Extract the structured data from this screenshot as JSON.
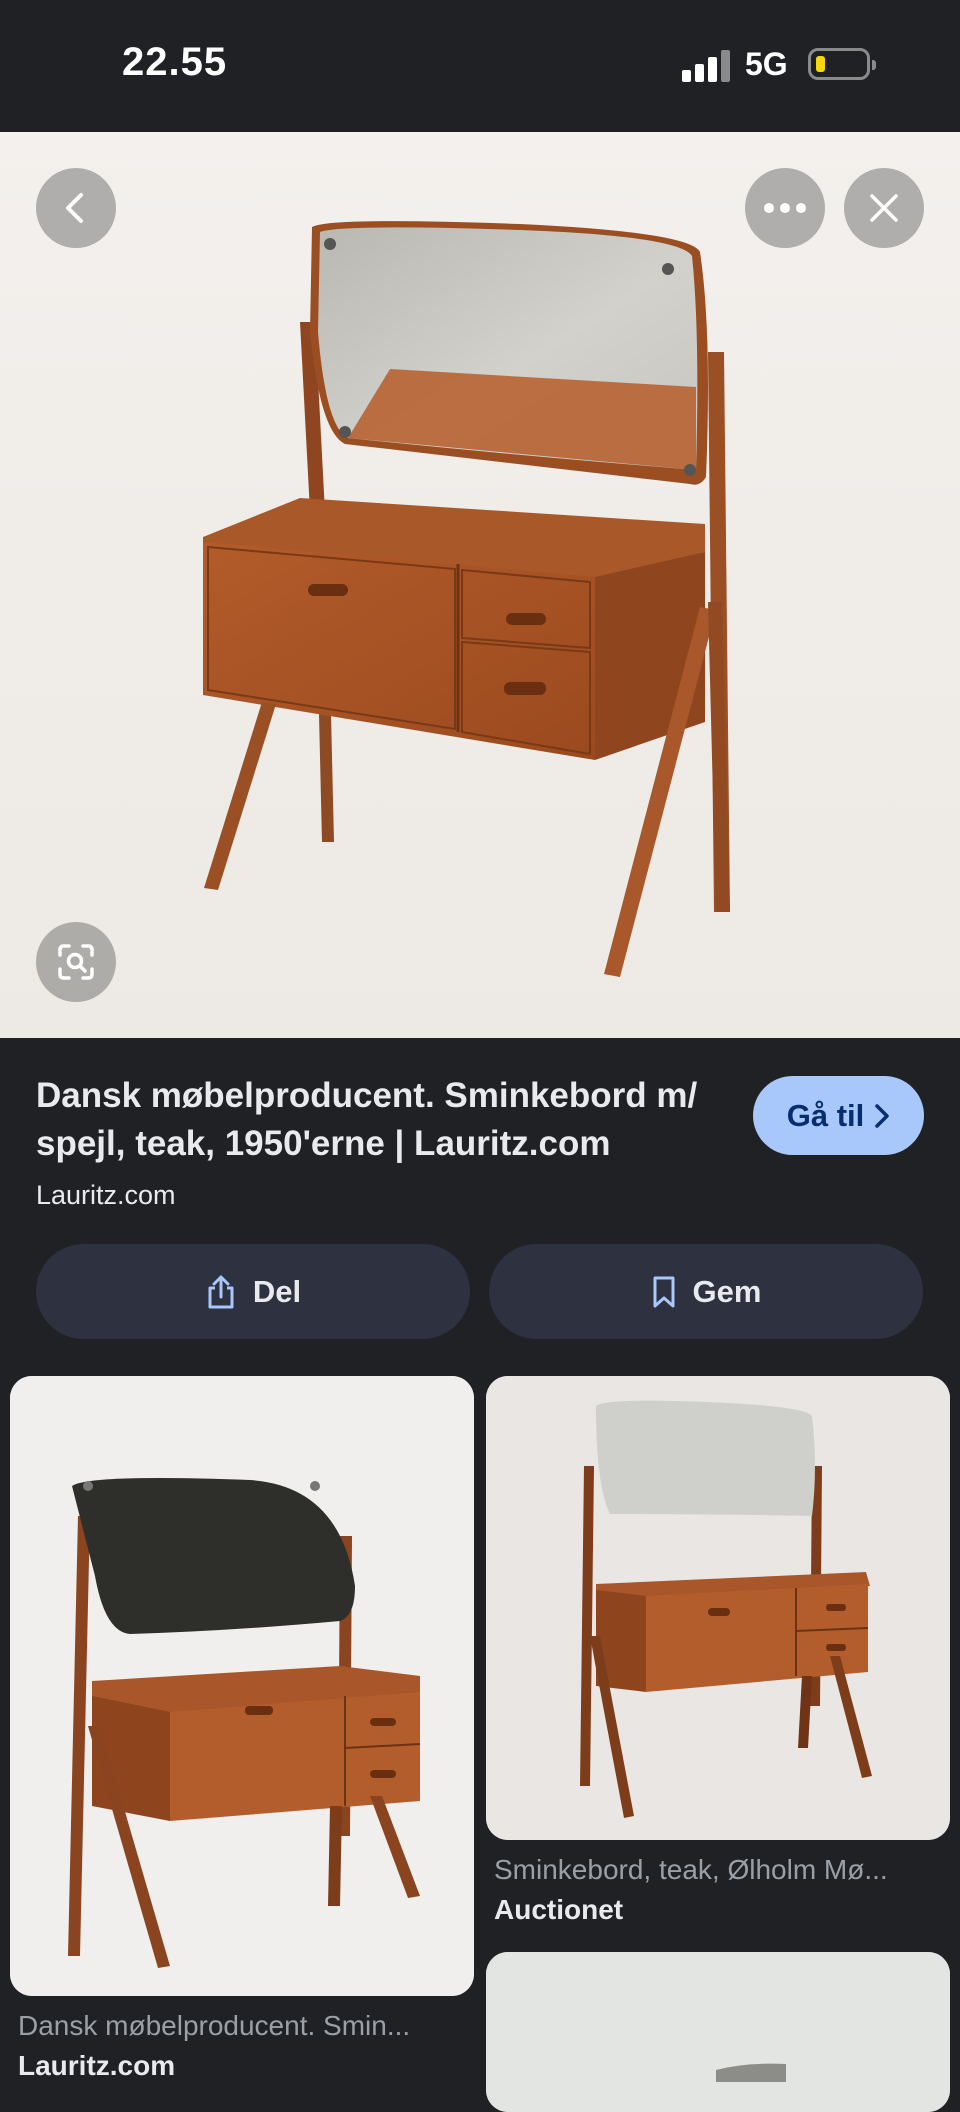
{
  "status_bar": {
    "time": "22.55",
    "network": "5G"
  },
  "hero": {
    "alt": "Teak vanity with mirror"
  },
  "result": {
    "title": "Dansk møbelproducent. Sminkebord m/ spejl, teak, 1950'erne | Lauritz.com",
    "source": "Lauritz.com",
    "goto_label": "Gå til"
  },
  "actions": {
    "share_label": "Del",
    "save_label": "Gem"
  },
  "related": [
    {
      "caption": "Dansk møbelproducent. Smin...",
      "source": "Lauritz.com"
    },
    {
      "caption": "Sminkebord, teak, Ølholm Mø...",
      "source": "Auctionet"
    }
  ],
  "colors": {
    "background": "#202124",
    "accent": "#a8c7fa",
    "button": "#2d3140"
  }
}
